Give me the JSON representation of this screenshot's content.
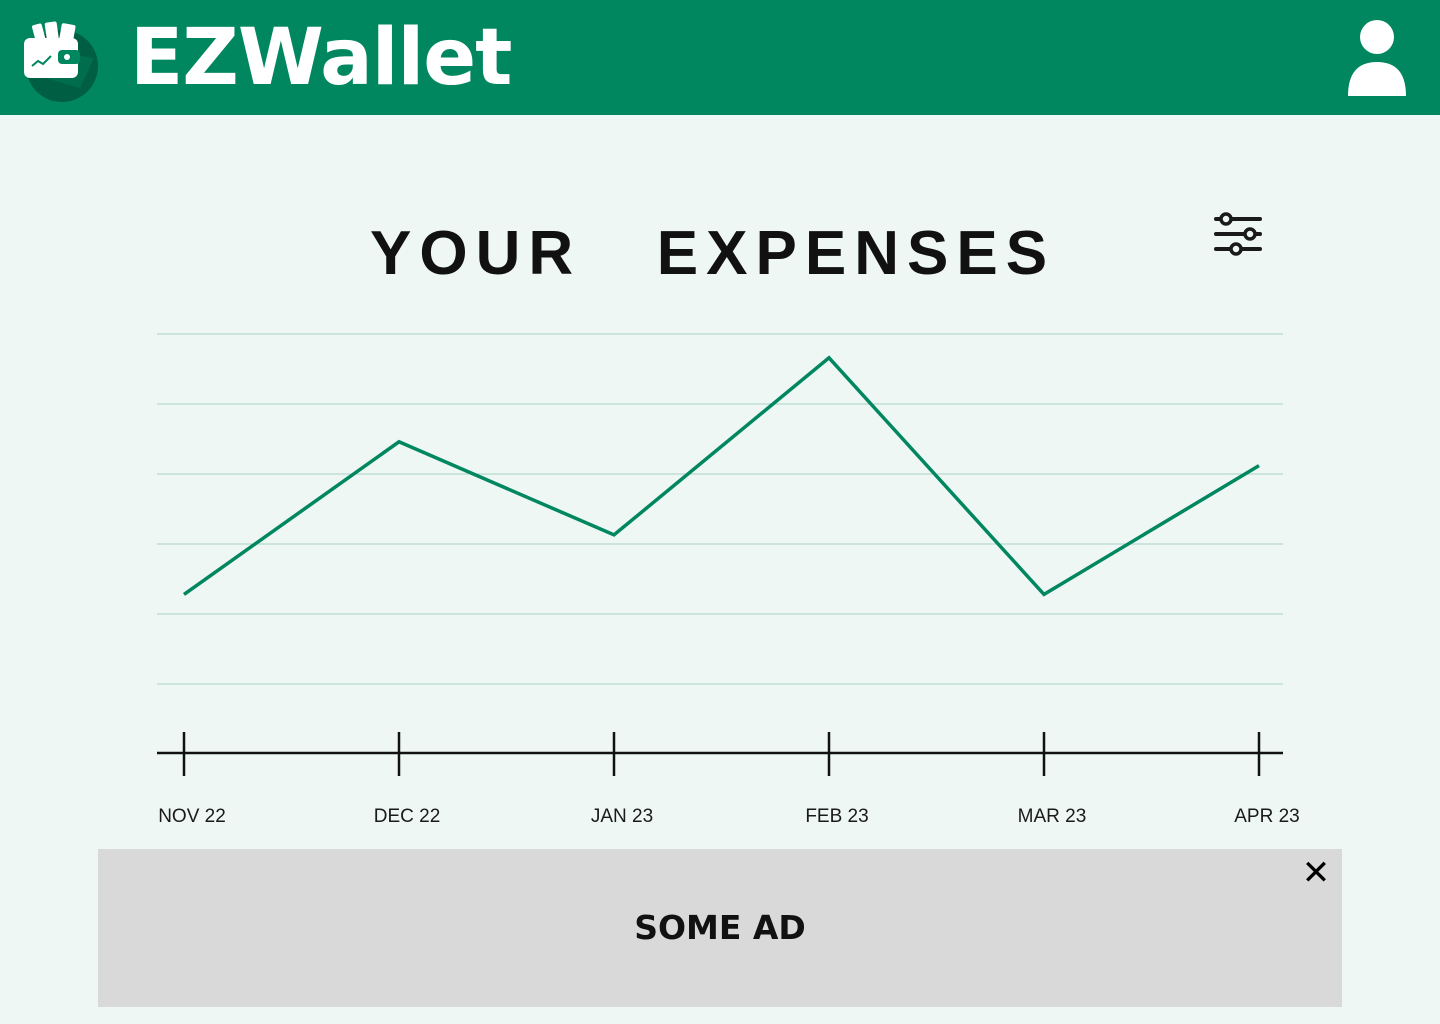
{
  "header": {
    "app_name": "EZWallet",
    "logo_icon": "wallet-icon",
    "profile_icon": "user-icon"
  },
  "main": {
    "title": "YOUR   EXPENSES",
    "filter_icon": "sliders-icon"
  },
  "chart_data": {
    "type": "line",
    "categories": [
      "NOV 22",
      "DEC 22",
      "JAN 23",
      "FEB 23",
      "MAR 23",
      "APR 23"
    ],
    "values": [
      1.28,
      3.46,
      2.13,
      4.66,
      1.28,
      3.12
    ],
    "ylim": [
      0,
      5
    ],
    "grid": true,
    "y_tick_labels_visible": false,
    "color": "#008760"
  },
  "ad": {
    "label": "SOME AD",
    "close_icon": "close-icon"
  },
  "colors": {
    "brand": "#008760",
    "background": "#eef7f4",
    "ad_background": "#d9d9d9"
  }
}
